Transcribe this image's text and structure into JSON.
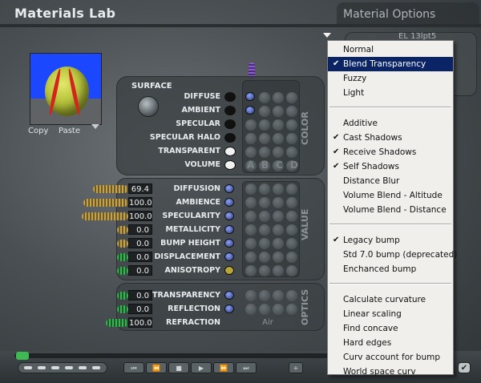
{
  "app": {
    "title": "Materials Lab",
    "options_title": "Material Options"
  },
  "preview": {
    "copy_label": "Copy",
    "paste_label": "Paste"
  },
  "surface": {
    "label": "SURFACE",
    "tab_label": "COLOR",
    "rows": [
      {
        "label": "DIFFUSE",
        "swatch": "#111111"
      },
      {
        "label": "AMBIENT",
        "swatch": "#111111"
      },
      {
        "label": "SPECULAR",
        "swatch": "#111111"
      },
      {
        "label": "SPECULAR HALO",
        "swatch": "#111111"
      },
      {
        "label": "TRANSPARENT",
        "swatch": "#f2f2f2"
      },
      {
        "label": "VOLUME",
        "swatch": "#f2f2f2"
      }
    ],
    "columns": [
      "A",
      "B",
      "C",
      "D"
    ]
  },
  "value": {
    "tab_label": "VALUE",
    "rows": [
      {
        "label": "DIFFUSION",
        "value": "69.4"
      },
      {
        "label": "AMBIENCE",
        "value": "100.0"
      },
      {
        "label": "SPECULARITY",
        "value": "100.0"
      },
      {
        "label": "METALLICITY",
        "value": "0.0"
      },
      {
        "label": "BUMP HEIGHT",
        "value": "0.0"
      },
      {
        "label": "DISPLACEMENT",
        "value": "0.0"
      },
      {
        "label": "ANISOTROPY",
        "value": "0.0"
      }
    ]
  },
  "optics": {
    "tab_label": "OPTICS",
    "rows": [
      {
        "label": "TRANSPARENCY",
        "value": "0.0"
      },
      {
        "label": "REFLECTION",
        "value": "0.0"
      },
      {
        "label": "REFRACTION",
        "value": "100.0"
      }
    ],
    "refraction_preset": "Air"
  },
  "material_options": {
    "menu": [
      {
        "label": "Normal",
        "checked": false,
        "selected": false
      },
      {
        "label": "Blend Transparency",
        "checked": true,
        "selected": true
      },
      {
        "label": "Fuzzy",
        "checked": false,
        "selected": false
      },
      {
        "label": "Light",
        "checked": false,
        "selected": false
      },
      {
        "label": "Additive",
        "checked": false,
        "selected": false
      },
      {
        "label": "Cast Shadows",
        "checked": true,
        "selected": false
      },
      {
        "label": "Receive Shadows",
        "checked": true,
        "selected": false
      },
      {
        "label": "Self Shadows",
        "checked": true,
        "selected": false
      },
      {
        "label": "Distance Blur",
        "checked": false,
        "selected": false
      },
      {
        "label": "Volume Blend - Altitude",
        "checked": false,
        "selected": false
      },
      {
        "label": "Volume Blend - Distance",
        "checked": false,
        "selected": false
      },
      {
        "label": "Legacy bump",
        "checked": true,
        "selected": false
      },
      {
        "label": "Std 7.0 bump (deprecated)",
        "checked": false,
        "selected": false
      },
      {
        "label": "Enchanced bump",
        "checked": false,
        "selected": false
      },
      {
        "label": "Calculate curvature",
        "checked": false,
        "selected": false
      },
      {
        "label": "Linear scaling",
        "checked": false,
        "selected": false
      },
      {
        "label": "Find concave",
        "checked": false,
        "selected": false
      },
      {
        "label": "Hard edges",
        "checked": false,
        "selected": false
      },
      {
        "label": "Curv account for bump",
        "checked": false,
        "selected": false
      },
      {
        "label": "World space curv",
        "checked": false,
        "selected": false
      }
    ],
    "check_glyph": "✔",
    "panel_label": "EL 13lpt5"
  },
  "playback": {
    "buttons": [
      "⏮",
      "⏪",
      "■",
      "▶",
      "⏩",
      "⏭"
    ],
    "plus_label": "+"
  },
  "colors": {
    "accent": "#0a2466",
    "gold_bar": "#c6a24a",
    "green_bar": "#39b354"
  }
}
